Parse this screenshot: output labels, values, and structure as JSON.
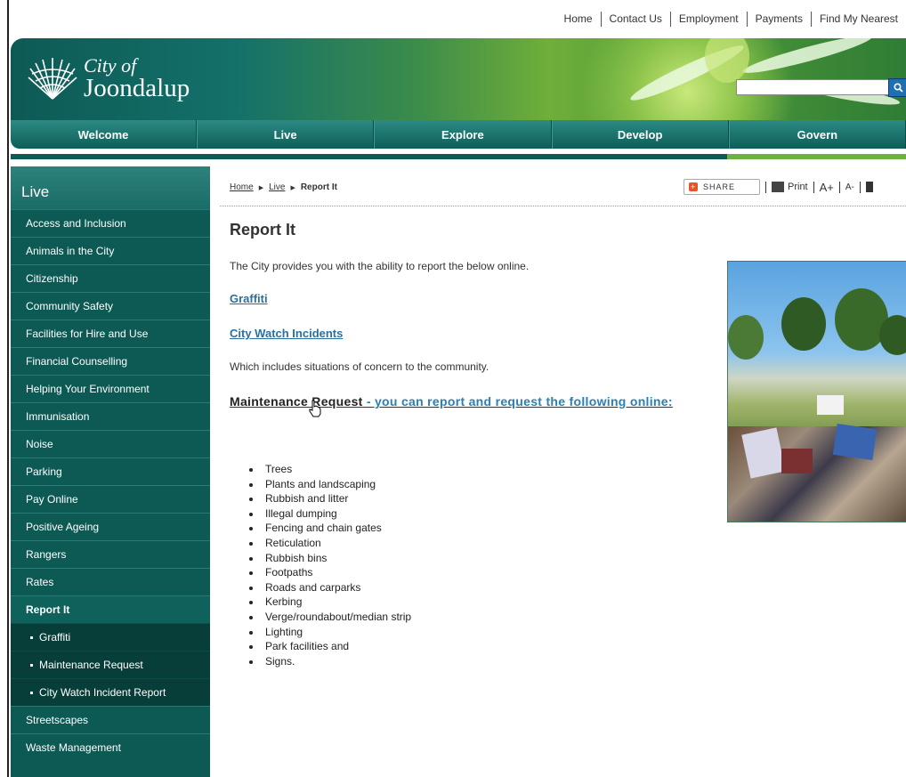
{
  "top_links": [
    "Home",
    "Contact Us",
    "Employment",
    "Payments",
    "Find My Nearest"
  ],
  "logo": {
    "line1": "City of",
    "line2": "Joondalup"
  },
  "search": {
    "placeholder": ""
  },
  "nav": [
    "Welcome",
    "Live",
    "Explore",
    "Develop",
    "Govern"
  ],
  "sidebar": {
    "heading": "Live",
    "items_before": [
      "Access and Inclusion",
      "Animals in the City",
      "Citizenship",
      "Community Safety",
      "Facilities for Hire and Use",
      "Financial Counselling",
      "Helping Your Environment",
      "Immunisation",
      "Noise",
      "Parking",
      "Pay Online",
      "Positive Ageing",
      "Rangers",
      "Rates"
    ],
    "active": "Report It",
    "sub_items": [
      "Graffiti",
      "Maintenance Request",
      "City Watch Incident Report"
    ],
    "items_after": [
      "Streetscapes",
      "Waste Management"
    ]
  },
  "breadcrumb": {
    "home": "Home",
    "live": "Live",
    "current": "Report It"
  },
  "tools": {
    "share": "SHARE",
    "print": "Print",
    "font_up": "A+",
    "font_down": "A-"
  },
  "page": {
    "title": "Report It",
    "intro": "The City provides you with the ability to report the below online.",
    "link_graffiti": "Graffiti",
    "link_citywatch": "City Watch Incidents",
    "citywatch_desc": "Which includes situations of concern to the community.",
    "maint_label": "Maintenance Request",
    "maint_suffix": " - you can report and request the following online:",
    "list": [
      "Trees",
      "Plants and landscaping",
      "Rubbish and litter",
      "Illegal dumping",
      "Fencing and chain gates",
      "Reticulation",
      "Rubbish bins",
      "Footpaths",
      "Roads and carparks",
      "Kerbing",
      "Verge/roundabout/median strip",
      "Lighting",
      "Park facilities and",
      "Signs."
    ]
  },
  "colors": {
    "teal": "#0d5a55",
    "link": "#2a6fa0",
    "accent_green": "#6fb042"
  }
}
